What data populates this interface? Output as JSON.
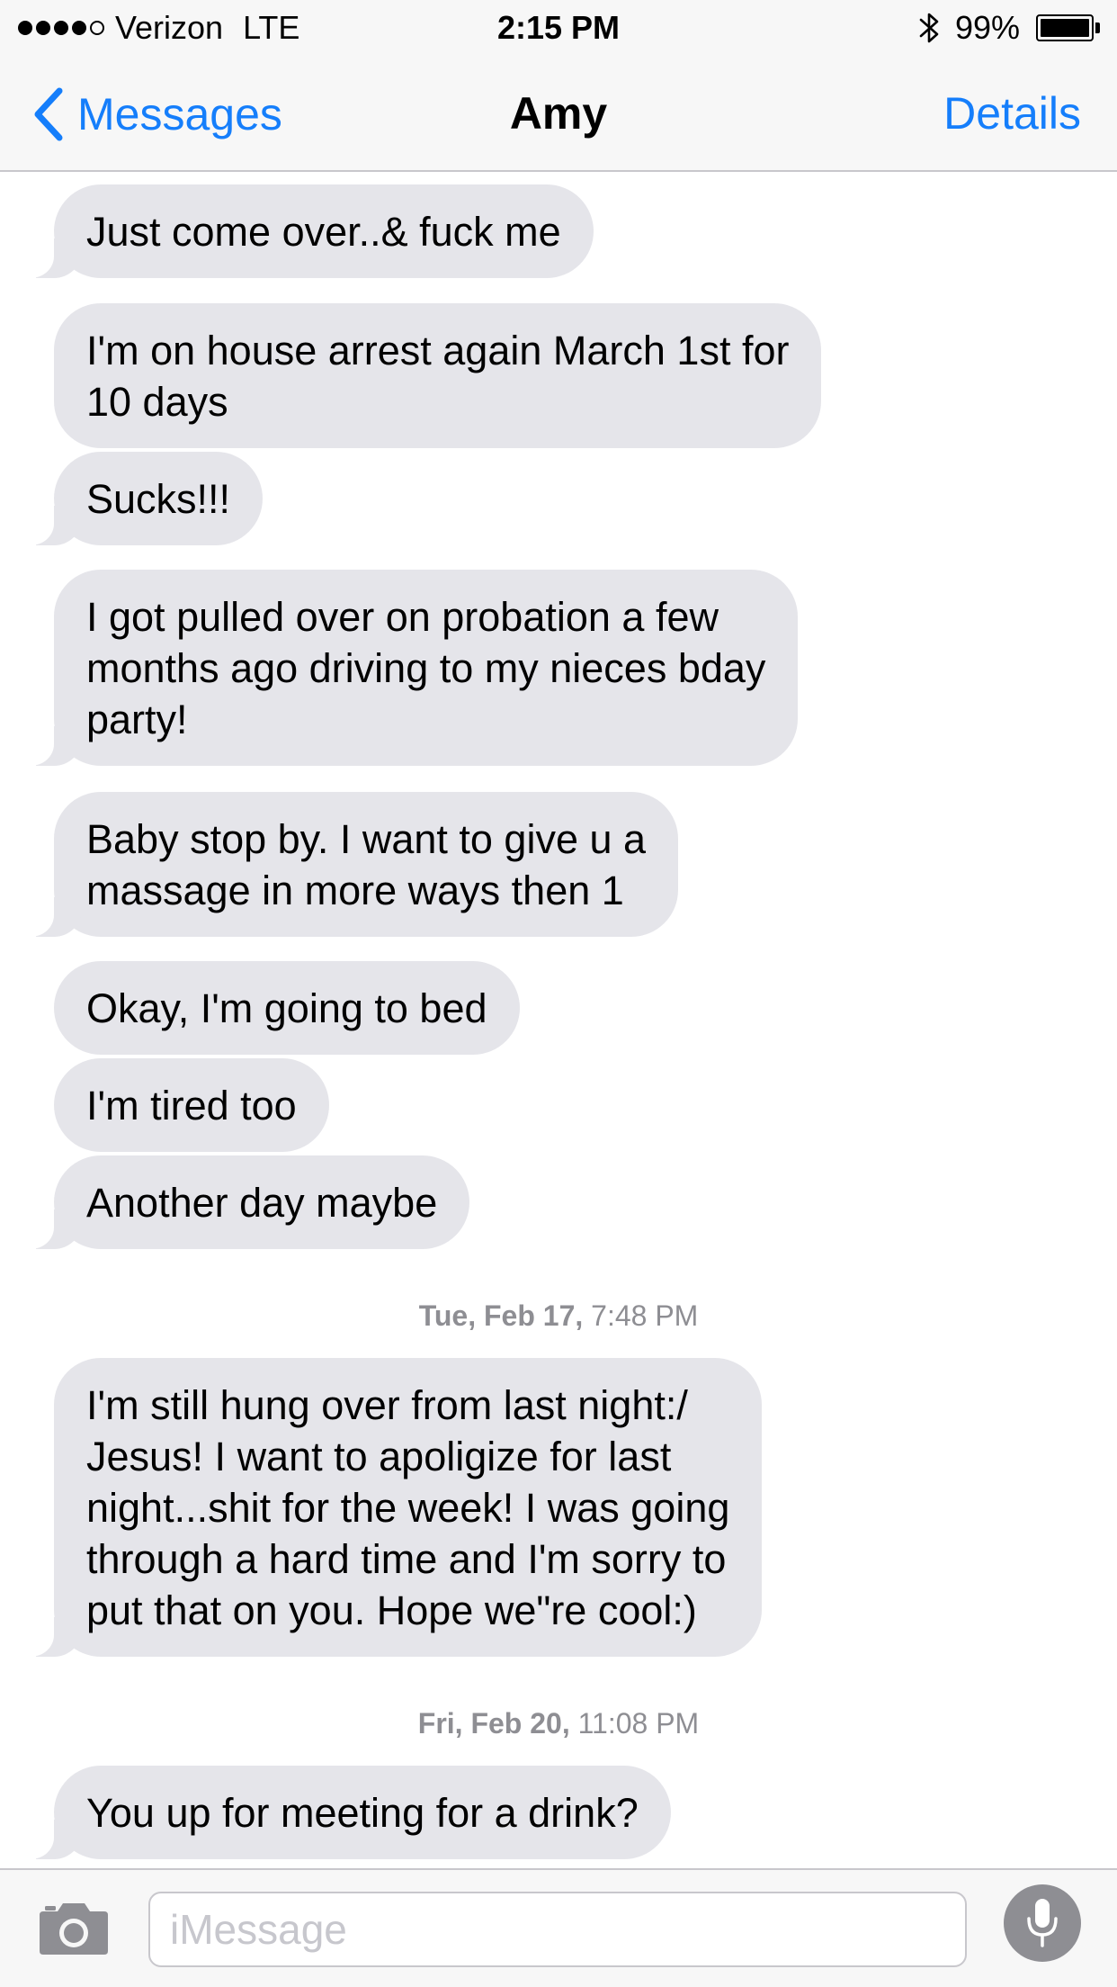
{
  "status_bar": {
    "carrier": "Verizon",
    "network": "LTE",
    "time": "2:15 PM",
    "battery_percent": "99%",
    "signal_bars_filled": 4,
    "signal_bars_total": 5,
    "battery_level": 0.99
  },
  "nav": {
    "back_label": "Messages",
    "title": "Amy",
    "details_label": "Details",
    "accent_color": "#157efb"
  },
  "messages": [
    {
      "sender": "Amy",
      "text": "Just come over..& fuck me"
    },
    {
      "sender": "Amy",
      "text": "I'm on house arrest again March 1st for\n10 days"
    },
    {
      "sender": "Amy",
      "text": "Sucks!!!"
    },
    {
      "sender": "Amy",
      "text": "I got pulled over on probation a few\nmonths ago driving to my nieces bday\nparty!"
    },
    {
      "sender": "Amy",
      "text": "Baby stop by. I want to give u a\nmassage in more ways then 1"
    },
    {
      "sender": "Amy",
      "text": "Okay, I'm going to bed"
    },
    {
      "sender": "Amy",
      "text": "I'm tired too"
    },
    {
      "sender": "Amy",
      "text": "Another day maybe"
    },
    {
      "sender": "Amy",
      "text": "I'm still hung over from last night:/\nJesus! I want to apoligize for last\nnight...shit for the week! I was going\nthrough a hard time and I'm sorry to\nput that on you. Hope we\"re cool:)"
    },
    {
      "sender": "Amy",
      "text": "You up for meeting for a drink?"
    }
  ],
  "timestamps": [
    {
      "day": "Tue, Feb 17,",
      "time": "7:48 PM"
    },
    {
      "day": "Fri, Feb 20,",
      "time": "11:08 PM"
    }
  ],
  "input_bar": {
    "placeholder": "iMessage",
    "camera_icon": "camera-icon",
    "mic_icon": "microphone-icon"
  },
  "colors": {
    "incoming_bubble": "#e5e5ea",
    "timestamp_text": "#8e8e93",
    "bar_background": "#f7f7f7"
  }
}
